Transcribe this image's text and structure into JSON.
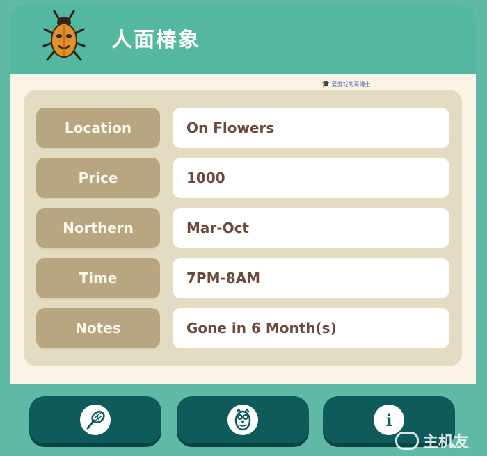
{
  "header": {
    "title": "人面椿象",
    "icon": "stink-bug-icon"
  },
  "watermark": {
    "text": "爱游戏的哥博士"
  },
  "details": [
    {
      "label": "Location",
      "value": "On Flowers"
    },
    {
      "label": "Price",
      "value": "1000"
    },
    {
      "label": "Northern",
      "value": "Mar-Oct"
    },
    {
      "label": "Time",
      "value": "7PM-8AM"
    },
    {
      "label": "Notes",
      "value": "Gone in 6 Month(s)"
    }
  ],
  "nav": [
    {
      "icon": "bug-net-icon"
    },
    {
      "icon": "owl-icon"
    },
    {
      "icon": "info-icon",
      "glyph": "i"
    }
  ],
  "brand": {
    "text": "主机友"
  },
  "colors": {
    "header": "#54b79f",
    "background": "#5fb9a4",
    "label_bg": "#b7a680",
    "value_text": "#6b4a3d",
    "button": "#0f5b5c"
  }
}
